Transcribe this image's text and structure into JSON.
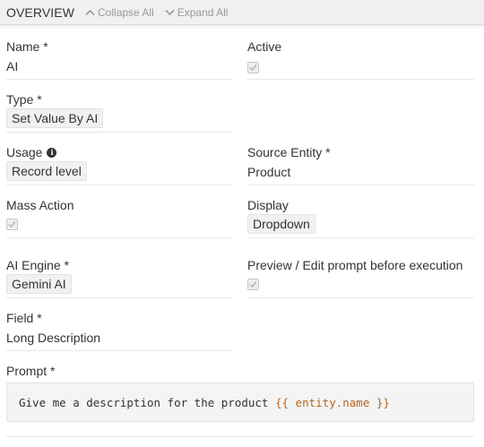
{
  "header": {
    "title": "OVERVIEW",
    "collapse_all": "Collapse All",
    "expand_all": "Expand All"
  },
  "fields": {
    "name": {
      "label": "Name *",
      "value": "AI"
    },
    "active": {
      "label": "Active",
      "checked": true
    },
    "type": {
      "label": "Type *",
      "value": "Set Value By AI"
    },
    "usage": {
      "label": "Usage",
      "value": "Record level"
    },
    "source_entity": {
      "label": "Source Entity *",
      "value": "Product"
    },
    "mass_action": {
      "label": "Mass Action",
      "checked": true
    },
    "display": {
      "label": "Display",
      "value": "Dropdown"
    },
    "ai_engine": {
      "label": "AI Engine *",
      "value": "Gemini AI"
    },
    "preview": {
      "label": "Preview / Edit prompt before execution",
      "checked": true
    },
    "field": {
      "label": "Field *",
      "value": "Long Description"
    },
    "prompt": {
      "label": "Prompt *",
      "text": "Give me a description for the product ",
      "template": "{{ entity.name }}"
    }
  },
  "colors": {
    "template_highlight": "#b5651d",
    "chip_background": "#f1f1f1",
    "header_background": "#f0f0f0"
  }
}
